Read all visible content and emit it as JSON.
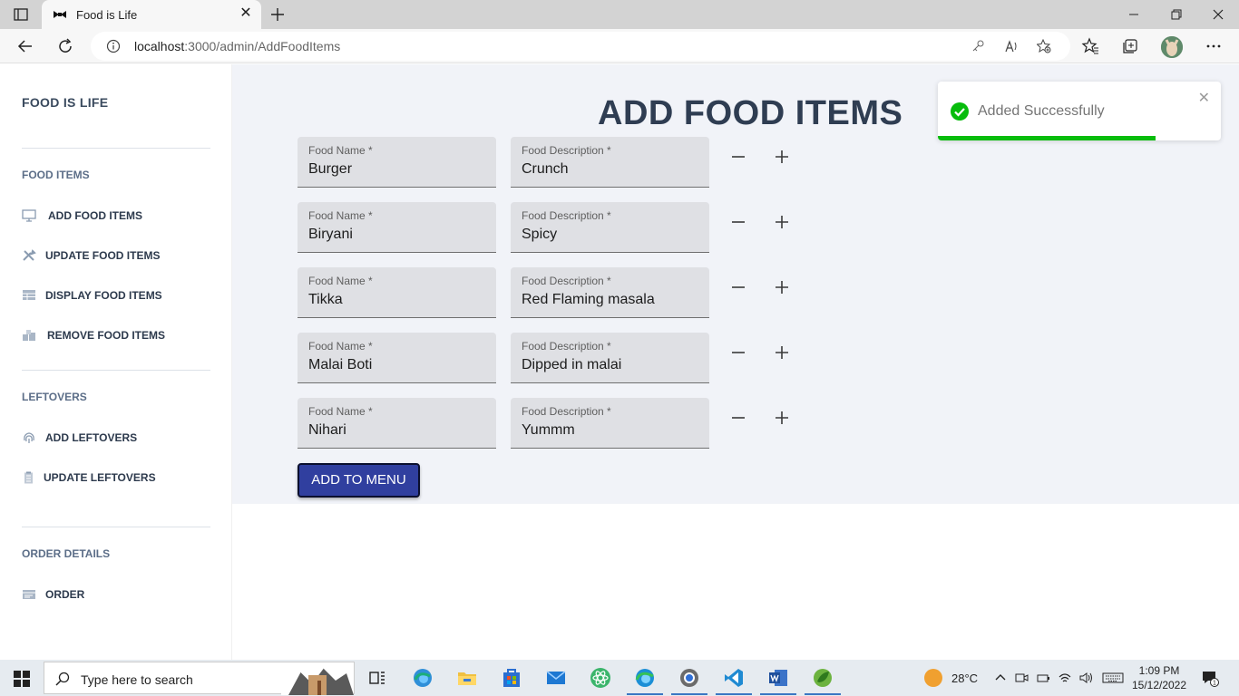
{
  "browser": {
    "tab_title": "Food is Life",
    "url_host": "localhost",
    "url_rest": ":3000/admin/AddFoodItems"
  },
  "sidebar": {
    "brand": "FOOD IS LIFE",
    "sections": [
      {
        "title": "FOOD ITEMS",
        "items": [
          {
            "label": "ADD FOOD ITEMS",
            "icon": "monitor-icon"
          },
          {
            "label": "UPDATE FOOD ITEMS",
            "icon": "tools-icon"
          },
          {
            "label": "DISPLAY FOOD ITEMS",
            "icon": "table-icon"
          },
          {
            "label": "REMOVE FOOD ITEMS",
            "icon": "boxes-icon"
          }
        ]
      },
      {
        "title": "LEFTOVERS",
        "items": [
          {
            "label": "ADD LEFTOVERS",
            "icon": "fingerprint-icon"
          },
          {
            "label": "UPDATE LEFTOVERS",
            "icon": "clipboard-icon"
          }
        ]
      },
      {
        "title": "ORDER DETAILS",
        "items": [
          {
            "label": "ORDER",
            "icon": "card-icon"
          }
        ]
      }
    ]
  },
  "main": {
    "heading": "ADD FOOD ITEMS",
    "name_label": "Food Name *",
    "desc_label": "Food Description *",
    "rows": [
      {
        "name": "Burger",
        "description": "Crunch"
      },
      {
        "name": "Biryani",
        "description": "Spicy"
      },
      {
        "name": "Tikka",
        "description": "Red Flaming masala"
      },
      {
        "name": "Malai Boti",
        "description": "Dipped in malai"
      },
      {
        "name": "Nihari",
        "description": "Yummm"
      }
    ],
    "submit_label": "ADD TO MENU"
  },
  "toast": {
    "message": "Added Successfully",
    "progress": 0.77,
    "color": "#07bc0c"
  },
  "taskbar": {
    "search_placeholder": "Type here to search",
    "temperature": "28°C",
    "time": "1:09 PM",
    "date": "15/12/2022",
    "notification_count": "1"
  }
}
